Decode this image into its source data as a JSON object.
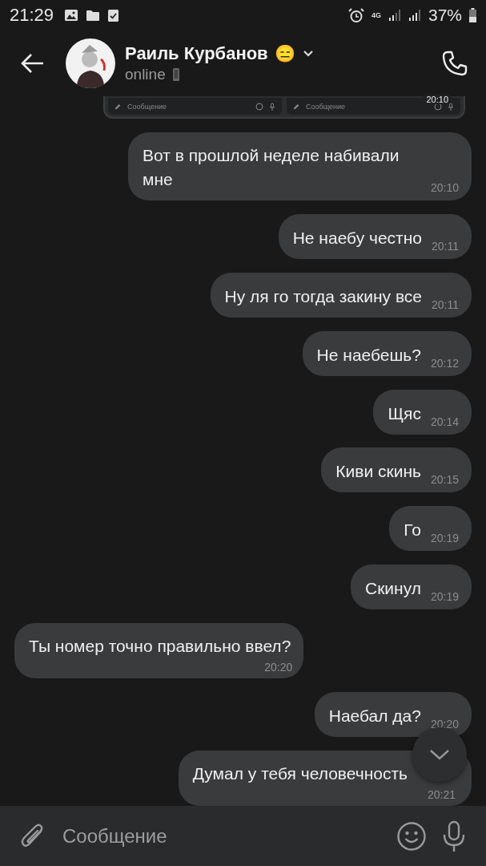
{
  "status_bar": {
    "time": "21:29",
    "network": "4G",
    "battery": "37%"
  },
  "header": {
    "name": "Раиль Курбанов",
    "emoji": "😑",
    "status": "online"
  },
  "forwarded_image": {
    "kind": "picture",
    "bars": [
      {
        "placeholder": "Сообщение"
      },
      {
        "placeholder": "Сообщение"
      }
    ],
    "time": "20:10"
  },
  "messages": [
    {
      "kind": "out",
      "text": "Вот в прошлой неделе набивали мне",
      "time": "20:10"
    },
    {
      "kind": "out",
      "text": "Не наебу честно",
      "time": "20:11"
    },
    {
      "kind": "out",
      "text": "Ну ля го тогда закину все",
      "time": "20:11"
    },
    {
      "kind": "out",
      "text": "Не наебешь?",
      "time": "20:12"
    },
    {
      "kind": "out",
      "text": "Щяс",
      "time": "20:14"
    },
    {
      "kind": "out",
      "text": "Киви скинь",
      "time": "20:15"
    },
    {
      "kind": "out",
      "text": "Го",
      "time": "20:19"
    },
    {
      "kind": "out",
      "text": "Скинул",
      "time": "20:19"
    },
    {
      "kind": "in",
      "text": "Ты номер точно правильно ввел?",
      "time": "20:20"
    },
    {
      "kind": "out",
      "text": "Наебал да?",
      "time": "20:20"
    },
    {
      "kind": "out",
      "text": "Думал у тебя человечность",
      "time": "20:21"
    }
  ],
  "composer": {
    "placeholder": "Сообщение"
  }
}
